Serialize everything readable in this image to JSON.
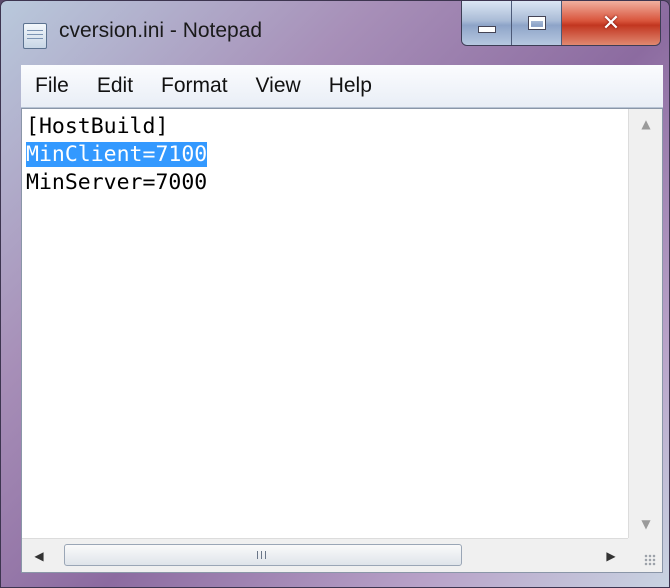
{
  "window": {
    "title": "cversion.ini - Notepad",
    "close_glyph": "✕",
    "app_icon": "notepad-icon"
  },
  "menu": {
    "items": [
      "File",
      "Edit",
      "Format",
      "View",
      "Help"
    ]
  },
  "editor": {
    "lines": [
      "[HostBuild]",
      "MinClient=7100",
      "MinServer=7000"
    ],
    "selected_line_index": 1,
    "selection_color": "#3399ff"
  },
  "scrollbars": {
    "up_arrow": "▲",
    "down_arrow": "▼",
    "left_arrow": "◀",
    "right_arrow": "▶"
  }
}
